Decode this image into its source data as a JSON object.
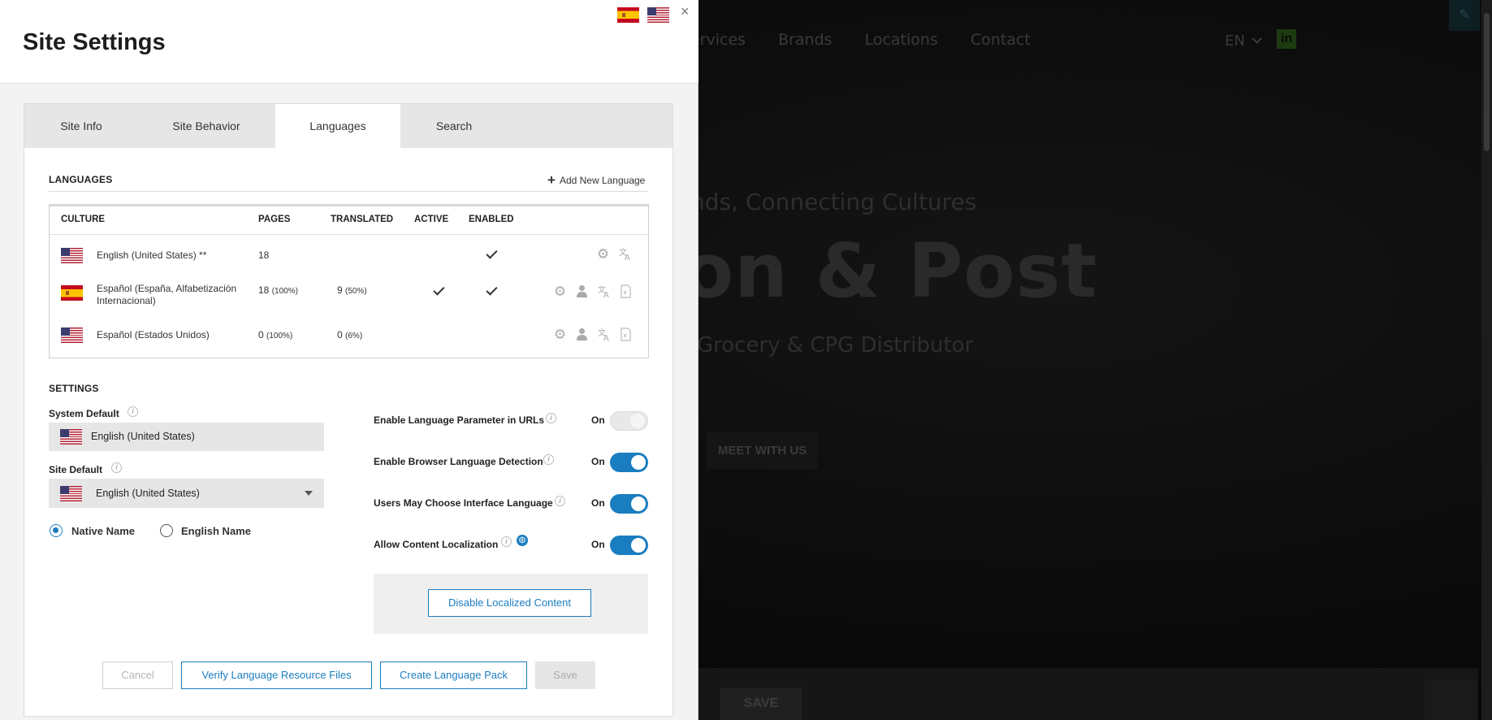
{
  "panel": {
    "title": "Site Settings",
    "close": "×"
  },
  "tabs": [
    {
      "label": "Site Info"
    },
    {
      "label": "Site Behavior"
    },
    {
      "label": "Languages",
      "active": true
    },
    {
      "label": "Search"
    }
  ],
  "languages": {
    "title": "LANGUAGES",
    "add_label": "Add New Language",
    "headers": {
      "culture": "CULTURE",
      "pages": "PAGES",
      "translated": "TRANSLATED",
      "active": "ACTIVE",
      "enabled": "ENABLED"
    },
    "rows": [
      {
        "flag": "us",
        "name": "English (United States) **",
        "pages": "18",
        "pages_pct": "",
        "translated": "",
        "translated_pct": "",
        "active": false,
        "enabled": true
      },
      {
        "flag": "es",
        "name": "Español (España, Alfabetización Internacional)",
        "pages": "18",
        "pages_pct": "(100%)",
        "translated": "9",
        "translated_pct": "(50%)",
        "active": true,
        "enabled": true
      },
      {
        "flag": "us",
        "name": "Español (Estados Unidos)",
        "pages": "0",
        "pages_pct": "(100%)",
        "translated": "0",
        "translated_pct": "(6%)",
        "active": false,
        "enabled": false
      }
    ]
  },
  "settings": {
    "title": "SETTINGS",
    "system_default_label": "System Default",
    "system_default_value": "English (United States)",
    "site_default_label": "Site Default",
    "site_default_value": "English (United States)",
    "radio_native": "Native Name",
    "radio_english": "English Name",
    "toggles": [
      {
        "label": "Enable Language Parameter in URLs",
        "state": "On",
        "on": true,
        "disabled": true
      },
      {
        "label": "Enable Browser Language Detection",
        "state": "On",
        "on": true,
        "disabled": false
      },
      {
        "label": "Users May Choose Interface Language",
        "state": "On",
        "on": true,
        "disabled": false
      },
      {
        "label": "Allow Content Localization",
        "state": "On",
        "on": true,
        "disabled": false
      }
    ],
    "disable_localized_label": "Disable Localized Content"
  },
  "footer": {
    "cancel": "Cancel",
    "verify": "Verify Language Resource Files",
    "create": "Create Language Pack",
    "save": "Save"
  },
  "background_site": {
    "nav": [
      "ervices",
      "Brands",
      "Locations",
      "Contact"
    ],
    "lang": "EN",
    "tagline": "nds, Connecting Cultures",
    "hero": "on & Post",
    "subtitle": "Grocery & CPG Distributor",
    "cta": "MEET WITH US",
    "save": "SAVE"
  },
  "colors": {
    "accent": "#1a7dc0",
    "panel_bg": "#f3f3f3",
    "tab_bg": "#e6e6e6"
  }
}
